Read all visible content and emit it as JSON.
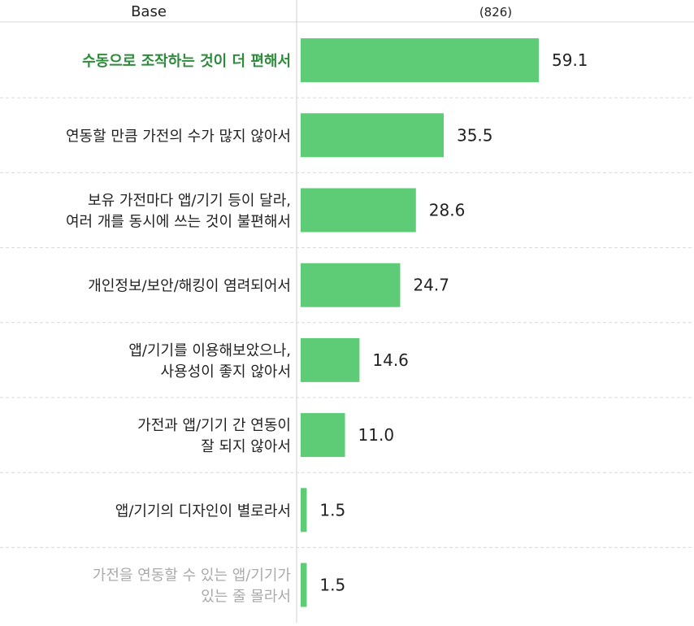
{
  "header": {
    "base_label": "Base",
    "base_value": "(826)"
  },
  "colors": {
    "bar": "#5ecb77",
    "highlight_label": "#2e8b3c",
    "label": "#222222",
    "muted_label": "#aaaaaa",
    "divider": "#d9d9d9"
  },
  "chart_data": {
    "type": "bar",
    "orientation": "horizontal",
    "categories": [
      [
        "수동으로 조작하는 것이 더 편해서"
      ],
      [
        "연동할 만큼 가전의 수가 많지 않아서"
      ],
      [
        "보유 가전마다 앱/기기 등이 달라,",
        "여러 개를 동시에 쓰는 것이 불편해서"
      ],
      [
        "개인정보/보안/해킹이 염려되어서"
      ],
      [
        "앱/기기를 이용해보았으나,",
        "사용성이 좋지 않아서"
      ],
      [
        "가전과 앱/기기 간 연동이",
        "잘 되지 않아서"
      ],
      [
        "앱/기기의 디자인이 별로라서"
      ],
      [
        "가전을 연동할 수 있는 앱/기기가",
        "있는 줄 몰라서"
      ]
    ],
    "values": [
      59.1,
      35.5,
      28.6,
      24.7,
      14.6,
      11.0,
      1.5,
      1.5
    ],
    "value_labels": [
      "59.1",
      "35.5",
      "28.6",
      "24.7",
      "14.6",
      "11.0",
      "1.5",
      "1.5"
    ],
    "label_style": [
      "highlight",
      "normal",
      "normal",
      "normal",
      "normal",
      "normal",
      "normal",
      "muted"
    ]
  }
}
